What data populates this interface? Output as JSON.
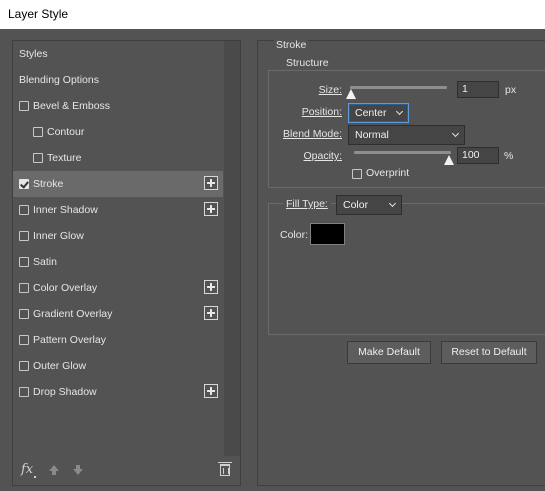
{
  "window": {
    "title": "Layer Style"
  },
  "styles_panel": {
    "items": [
      {
        "label": "Styles",
        "has_checkbox": false,
        "checked": false,
        "indent": 0,
        "has_plus": false,
        "selected": false
      },
      {
        "label": "Blending Options",
        "has_checkbox": false,
        "checked": false,
        "indent": 0,
        "has_plus": false,
        "selected": false
      },
      {
        "label": "Bevel & Emboss",
        "has_checkbox": true,
        "checked": false,
        "indent": 0,
        "has_plus": false,
        "selected": false
      },
      {
        "label": "Contour",
        "has_checkbox": true,
        "checked": false,
        "indent": 1,
        "has_plus": false,
        "selected": false
      },
      {
        "label": "Texture",
        "has_checkbox": true,
        "checked": false,
        "indent": 1,
        "has_plus": false,
        "selected": false
      },
      {
        "label": "Stroke",
        "has_checkbox": true,
        "checked": true,
        "indent": 0,
        "has_plus": true,
        "selected": true
      },
      {
        "label": "Inner Shadow",
        "has_checkbox": true,
        "checked": false,
        "indent": 0,
        "has_plus": true,
        "selected": false
      },
      {
        "label": "Inner Glow",
        "has_checkbox": true,
        "checked": false,
        "indent": 0,
        "has_plus": false,
        "selected": false
      },
      {
        "label": "Satin",
        "has_checkbox": true,
        "checked": false,
        "indent": 0,
        "has_plus": false,
        "selected": false
      },
      {
        "label": "Color Overlay",
        "has_checkbox": true,
        "checked": false,
        "indent": 0,
        "has_plus": true,
        "selected": false
      },
      {
        "label": "Gradient Overlay",
        "has_checkbox": true,
        "checked": false,
        "indent": 0,
        "has_plus": true,
        "selected": false
      },
      {
        "label": "Pattern Overlay",
        "has_checkbox": true,
        "checked": false,
        "indent": 0,
        "has_plus": false,
        "selected": false
      },
      {
        "label": "Outer Glow",
        "has_checkbox": true,
        "checked": false,
        "indent": 0,
        "has_plus": false,
        "selected": false
      },
      {
        "label": "Drop Shadow",
        "has_checkbox": true,
        "checked": false,
        "indent": 0,
        "has_plus": true,
        "selected": false
      }
    ],
    "footer": {
      "fx_label": "fx"
    }
  },
  "stroke": {
    "title": "Stroke",
    "structure": {
      "title": "Structure",
      "size": {
        "label": "Size:",
        "value": "1",
        "unit": "px",
        "slider_fraction": 0.0
      },
      "position": {
        "label": "Position:",
        "value": "Center"
      },
      "blend_mode": {
        "label": "Blend Mode:",
        "value": "Normal"
      },
      "opacity": {
        "label": "Opacity:",
        "value": "100",
        "unit": "%",
        "slider_fraction": 1.0
      },
      "overprint": {
        "label": "Overprint",
        "checked": false
      }
    },
    "fill": {
      "fill_type_label": "Fill Type:",
      "fill_type_value": "Color",
      "color_label": "Color:",
      "color_value": "#000000"
    },
    "buttons": {
      "make_default": "Make Default",
      "reset_default": "Reset to Default"
    }
  }
}
